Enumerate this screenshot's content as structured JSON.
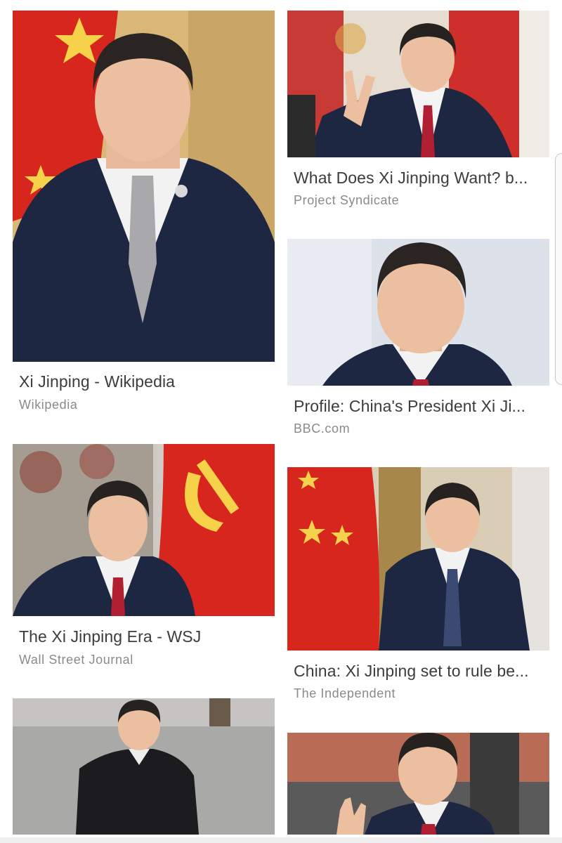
{
  "results": [
    {
      "title": "Xi Jinping - Wikipedia",
      "source": "Wikipedia",
      "image": "portrait-photo"
    },
    {
      "title": "What Does Xi Jinping Want? b...",
      "source": "Project Syndicate",
      "image": "waving-photo"
    },
    {
      "title": "Profile: China's President Xi Ji...",
      "source": "BBC.com",
      "image": "headshot-photo"
    },
    {
      "title": "The Xi Jinping Era - WSJ",
      "source": "Wall Street Journal",
      "image": "flag-photo"
    },
    {
      "title": "China: Xi Jinping set to rule be...",
      "source": "The Independent",
      "image": "standing-photo"
    },
    {
      "title": "",
      "source": "",
      "image": "outdoor-photo"
    },
    {
      "title": "",
      "source": "",
      "image": "waving-outdoor-photo"
    }
  ],
  "colors": {
    "title": "#3c3c3c",
    "source": "#8a8a8a",
    "flag_red": "#d7261e",
    "flag_yellow": "#f6d24a",
    "suit": "#1e2742"
  }
}
